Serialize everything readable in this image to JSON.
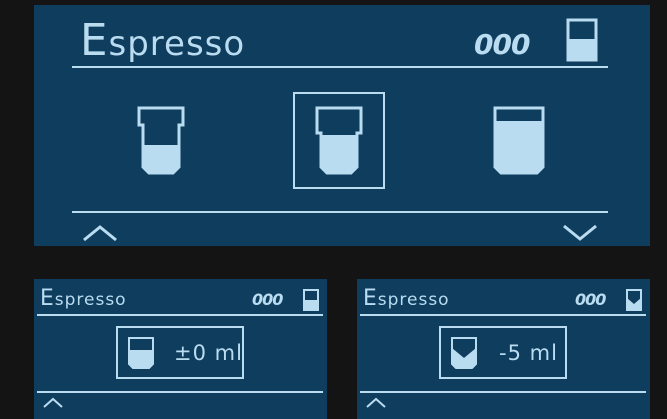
{
  "colors": {
    "background": "#141414",
    "panel": "#0f3d5e",
    "foreground": "#b9dcf1"
  },
  "main_screen": {
    "title": "Espresso",
    "strength": "000",
    "strength_icon": "coffee-bean-icon",
    "cup_icon": "cup-size-icon",
    "cup_options": [
      {
        "icon": "cup-small-icon",
        "selected": false
      },
      {
        "icon": "cup-medium-icon",
        "selected": true
      },
      {
        "icon": "cup-large-icon",
        "selected": false
      }
    ],
    "nav": {
      "up_icon": "chevron-up-icon",
      "down_icon": "chevron-down-icon"
    }
  },
  "left_screen": {
    "title": "Espresso",
    "strength": "000",
    "volume": "±0 ml",
    "volume_icon": "cup-volume-icon",
    "nav_up_icon": "chevron-up-icon"
  },
  "right_screen": {
    "title": "Espresso",
    "strength": "000",
    "volume": "-5 ml",
    "volume_icon": "cup-reduce-icon",
    "nav_up_icon": "chevron-up-icon"
  }
}
